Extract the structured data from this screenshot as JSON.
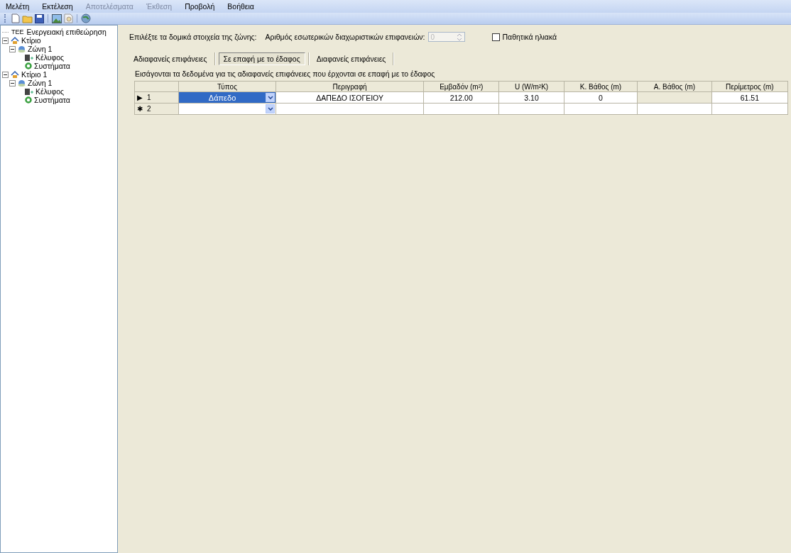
{
  "menu": [
    {
      "label": "Μελέτη",
      "disabled": false
    },
    {
      "label": "Εκτέλεση",
      "disabled": false
    },
    {
      "label": "Αποτελέσματα",
      "disabled": true
    },
    {
      "label": "Έκθεση",
      "disabled": true
    },
    {
      "label": "Προβολή",
      "disabled": false
    },
    {
      "label": "Βοήθεια",
      "disabled": false
    }
  ],
  "toolbar": [
    {
      "kind": "new"
    },
    {
      "kind": "open"
    },
    {
      "kind": "save"
    },
    {
      "kind": "sep"
    },
    {
      "kind": "image"
    },
    {
      "kind": "preview"
    },
    {
      "kind": "sep"
    },
    {
      "kind": "globe"
    }
  ],
  "tree": {
    "label": "Ενεργειακή επιθεώρηση",
    "badge": "TEE",
    "children": [
      {
        "label": "Κτίριο",
        "kind": "building",
        "expanded": true,
        "children": [
          {
            "label": "Ζώνη 1",
            "kind": "zone",
            "expanded": true,
            "children": [
              {
                "label": "Κέλυφος",
                "kind": "shell"
              },
              {
                "label": "Συστήματα",
                "kind": "systems"
              }
            ]
          }
        ]
      },
      {
        "label": "Κτίριο 1",
        "kind": "building",
        "expanded": true,
        "children": [
          {
            "label": "Ζώνη 1",
            "kind": "zone",
            "expanded": true,
            "children": [
              {
                "label": "Κέλυφος",
                "kind": "shell"
              },
              {
                "label": "Συστήματα",
                "kind": "systems"
              }
            ]
          }
        ]
      }
    ]
  },
  "zone_prompt": "Επιλέξτε τα δομικά στοιχεία της ζώνης:",
  "partitions": {
    "label": "Αριθμός εσωτερικών διαχωριστικών επιφανειών:",
    "value": "0",
    "disabled": true
  },
  "passive_solar": {
    "label": "Παθητικά ηλιακά",
    "checked": false
  },
  "tabs": [
    {
      "label": "Αδιαφανείς επιφάνειες",
      "selected": false
    },
    {
      "label": "Σε επαφή με το έδαφος",
      "selected": true
    },
    {
      "label": "Διαφανείς επιφάνειες",
      "selected": false
    }
  ],
  "instructions": "Εισάγονται τα δεδομένα για τις αδιαφανείς επιφάνειες που έρχονται σε επαφή με το έδαφος",
  "table": {
    "columns": [
      "Τύπος",
      "Περιγραφή",
      "Εμβαδόν (m²)",
      "U (W/m²K)",
      "Κ. Βάθος (m)",
      "Α. Βάθος (m)",
      "Περίμετρος (m)"
    ],
    "rows": [
      {
        "marker": "▶",
        "number": "1",
        "cells": [
          {
            "text": "Δάπεδο",
            "disabled": false
          },
          {
            "text": "ΔΑΠΕΔΟ ΙΣΟΓΕΙΟΥ",
            "disabled": false
          },
          {
            "text": "212.00",
            "disabled": false
          },
          {
            "text": "3.10",
            "disabled": false
          },
          {
            "text": "0",
            "disabled": false
          },
          {
            "text": "",
            "disabled": true
          },
          {
            "text": "61.51",
            "disabled": false
          }
        ],
        "selected": true
      },
      {
        "marker": "✱",
        "number": "2",
        "cells": [
          {
            "text": "",
            "disabled": false
          },
          {
            "text": "",
            "disabled": false
          },
          {
            "text": "",
            "disabled": false
          },
          {
            "text": "",
            "disabled": false
          },
          {
            "text": "",
            "disabled": false
          },
          {
            "text": "",
            "disabled": false
          },
          {
            "text": "",
            "disabled": false
          }
        ],
        "selected": false
      }
    ]
  }
}
